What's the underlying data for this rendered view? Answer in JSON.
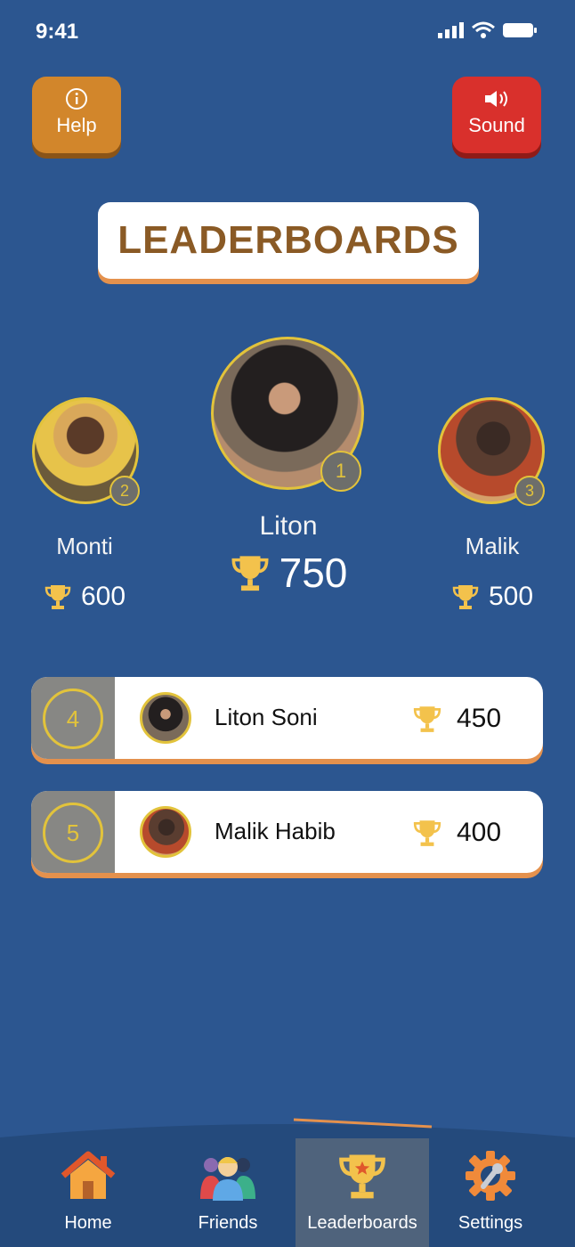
{
  "status_bar": {
    "time": "9:41"
  },
  "top_buttons": {
    "help_label": "Help",
    "sound_label": "Sound"
  },
  "title": "LEADERBOARDS",
  "podium": {
    "first": {
      "rank": "1",
      "name": "Liton",
      "score": "750"
    },
    "second": {
      "rank": "2",
      "name": "Monti",
      "score": "600"
    },
    "third": {
      "rank": "3",
      "name": "Malik",
      "score": "500"
    }
  },
  "list": [
    {
      "rank": "4",
      "name": "Liton Soni",
      "score": "450"
    },
    {
      "rank": "5",
      "name": "Malik Habib",
      "score": "400"
    }
  ],
  "nav": [
    {
      "label": "Home",
      "icon": "home-icon"
    },
    {
      "label": "Friends",
      "icon": "friends-icon"
    },
    {
      "label": "Leaderboards",
      "icon": "trophy-icon",
      "active": true
    },
    {
      "label": "Settings",
      "icon": "settings-icon"
    }
  ],
  "colors": {
    "background": "#2c5690",
    "accent_gold": "#e2c33b",
    "help": "#d2862b",
    "sound": "#d9302c",
    "title_text": "#8a5a25"
  }
}
